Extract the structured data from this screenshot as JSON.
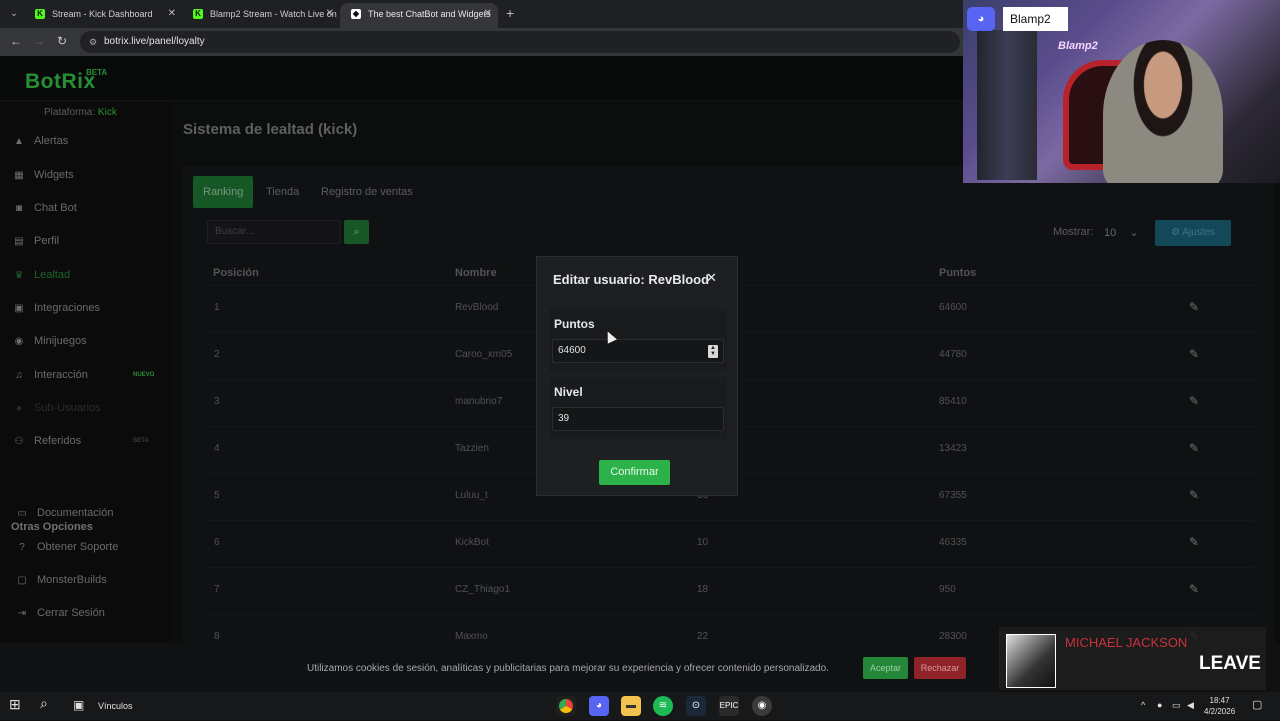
{
  "browser": {
    "tabs": [
      {
        "label": "Stream - Kick Dashboard",
        "favicon": "K",
        "color": "#53fc18"
      },
      {
        "label": "Blamp2 Stream - Watch Live on",
        "favicon": "K",
        "color": "#53fc18"
      },
      {
        "label": "The best ChatBot and Widgets",
        "favicon": "◆",
        "color": "#ffffff"
      }
    ],
    "url": "botrix.live/panel/loyalty"
  },
  "app": {
    "logo": "BotRix",
    "logo_badge": "BETA",
    "platform_label": "Plataforma:",
    "platform_value": "Kick",
    "sidebar": [
      {
        "label": "Alertas",
        "icon": "warning-icon"
      },
      {
        "label": "Widgets",
        "icon": "grid-icon"
      },
      {
        "label": "Chat Bot",
        "icon": "robot-icon"
      },
      {
        "label": "Perfil",
        "icon": "id-card-icon"
      },
      {
        "label": "Lealtad",
        "icon": "trophy-icon",
        "active": true
      },
      {
        "label": "Integraciones",
        "icon": "plug-icon"
      },
      {
        "label": "Minijuegos",
        "icon": "gamepad-icon"
      },
      {
        "label": "Interacción",
        "icon": "music-icon",
        "badge": "NUEVO"
      },
      {
        "label": "Sub-Usuarios",
        "icon": "users-icon",
        "dim": true
      },
      {
        "label": "Referidos",
        "icon": "referral-icon",
        "badge": "BETA"
      }
    ],
    "other_heading": "Otras Opciones",
    "other_items": [
      {
        "label": "Documentación",
        "icon": "book-icon"
      },
      {
        "label": "Obtener Soporte",
        "icon": "help-icon"
      },
      {
        "label": "MonsterBuilds",
        "icon": "monitor-icon"
      },
      {
        "label": "Cerrar Sesión",
        "icon": "logout-icon"
      }
    ]
  },
  "page": {
    "title": "Sistema de lealtad (kick)",
    "tabs": [
      "Ranking",
      "Tienda",
      "Registro de ventas"
    ],
    "search_placeholder": "Buscar...",
    "show_label": "Mostrar:",
    "show_value": "10",
    "settings_label": "Ajustes",
    "columns": [
      "Posición",
      "Nombre",
      "Puntos"
    ],
    "rows": [
      {
        "pos": "1",
        "name": "RevBlood",
        "level": "",
        "points": "64600"
      },
      {
        "pos": "2",
        "name": "Caroo_xm05",
        "level": "",
        "points": "44780"
      },
      {
        "pos": "3",
        "name": "manubrio7",
        "level": "",
        "points": "85410"
      },
      {
        "pos": "4",
        "name": "Tazzien",
        "level": "",
        "points": "13423"
      },
      {
        "pos": "5",
        "name": "Luluu_t",
        "level": "36",
        "points": "67355"
      },
      {
        "pos": "6",
        "name": "KickBot",
        "level": "10",
        "points": "46335"
      },
      {
        "pos": "7",
        "name": "CZ_Thiago1",
        "level": "18",
        "points": "950"
      },
      {
        "pos": "8",
        "name": "Maxmo",
        "level": "22",
        "points": "28300"
      }
    ]
  },
  "modal": {
    "title": "Editar usuario: RevBlood",
    "points_label": "Puntos",
    "points_value": "64600",
    "level_label": "Nivel",
    "level_value": "39",
    "confirm_label": "Confirmar"
  },
  "cookie": {
    "text": "Utilizamos cookies de sesión, analíticas y publicitarias para mejorar su experiencia y ofrecer contenido personalizado.",
    "accept": "Aceptar",
    "reject": "Rechazar"
  },
  "overlays": {
    "cam_name": "Blamp2",
    "cam_neon": "Blamp2",
    "music_artist": "MICHAEL JACKSON",
    "music_song": "LEAVE"
  },
  "taskbar": {
    "vinculos": "Vínculos",
    "time": "18:47",
    "date": "4/2/2026"
  }
}
